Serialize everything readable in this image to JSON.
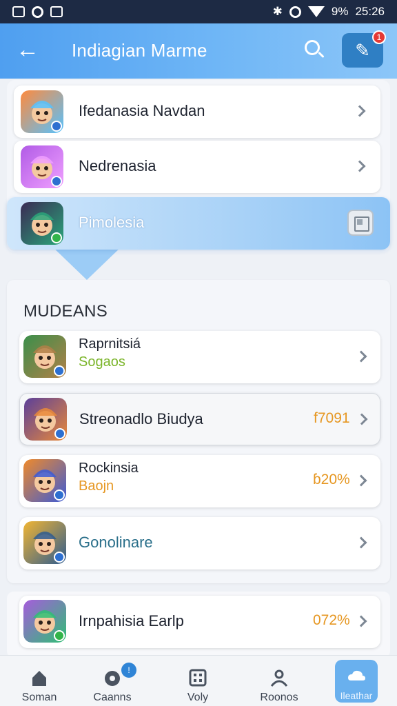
{
  "status_bar": {
    "battery": "9%",
    "time": "25:26"
  },
  "app_bar": {
    "title": "Indiagian Marme",
    "notification_count": "1"
  },
  "top_list": [
    {
      "title": "Ifedanasia Navdan",
      "icon": "game-girl-icon",
      "colors": [
        "#ff8a3d",
        "#56c2ff"
      ]
    },
    {
      "title": "Nedrenasia",
      "icon": "purple-dragon-icon",
      "colors": [
        "#b15be6",
        "#f0a0ff"
      ]
    },
    {
      "title": "Pimolesia",
      "icon": "warrior-icon",
      "colors": [
        "#3b2a54",
        "#2aa67a"
      ],
      "selected": true
    }
  ],
  "section": {
    "heading": "MUDEANS"
  },
  "games": [
    {
      "title": "Raprnitsiá",
      "subtitle": "Sogaos",
      "subtitle_color": "#7bb52a",
      "value": "",
      "icon": "goblin-hat-icon",
      "colors": [
        "#3a8f4a",
        "#b28048"
      ]
    },
    {
      "title": "Streonadlo Biudya",
      "subtitle": "",
      "value": "f7091",
      "icon": "wizard-girl-icon",
      "colors": [
        "#5b3f9a",
        "#e98a3a"
      ]
    },
    {
      "title": "Rockinsia",
      "subtitle": "Baojn",
      "subtitle_color": "#e69722",
      "value": "ɓ20%",
      "icon": "robot-knight-icon",
      "colors": [
        "#f08a2a",
        "#3c5bd6"
      ]
    },
    {
      "title": "Gonolinare",
      "subtitle": "",
      "value": "",
      "title_color": "#2a6f8a",
      "icon": "fox-warrior-icon",
      "colors": [
        "#f1b533",
        "#2f5c8f"
      ]
    },
    {
      "title": "Irnpahisia Earlp",
      "subtitle": "",
      "value": "072%",
      "icon": "purple-dino-icon",
      "colors": [
        "#a65cdc",
        "#2fbf74"
      ]
    }
  ],
  "bottom_nav": [
    {
      "label": "Soman",
      "icon": "home-icon"
    },
    {
      "label": "Caanns",
      "icon": "compass-icon",
      "badge": "!"
    },
    {
      "label": "Voly",
      "icon": "grid-icon"
    },
    {
      "label": "Roonos",
      "icon": "group-icon"
    },
    {
      "label": "Ileathar",
      "icon": "cloud-icon",
      "active": true
    }
  ]
}
